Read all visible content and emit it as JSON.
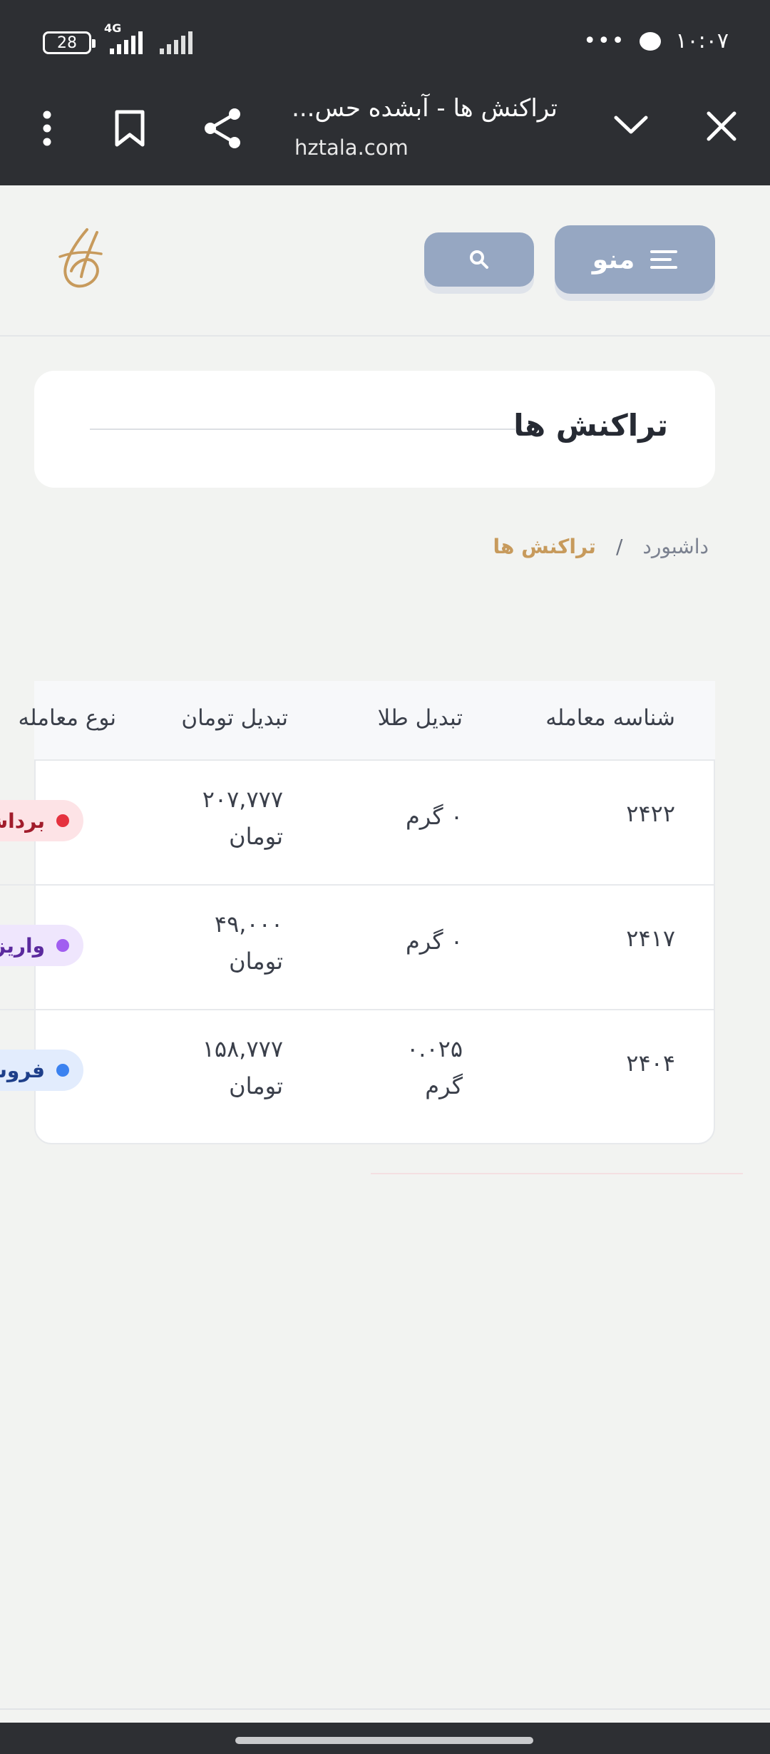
{
  "status_bar": {
    "battery": "28",
    "network": "4G",
    "time": "۱۰:۰۷",
    "more": "•••"
  },
  "browser": {
    "title": "تراکنش ها - آبشده حس...",
    "url": "hztala.com"
  },
  "header": {
    "menu_label": "منو"
  },
  "page": {
    "title": "تراکنش ها"
  },
  "breadcrumb": {
    "home": "داشبورد",
    "separator": "/",
    "current": "تراکنش ها"
  },
  "table": {
    "headers": {
      "id": "شناسه معامله",
      "gold": "تبدیل طلا",
      "toman": "تبدیل تومان",
      "type": "نوع معامله"
    },
    "rows": [
      {
        "id": "۲۴۲۲",
        "gold_value": "۰ گرم",
        "gold_unit": "",
        "toman_value": "۲۰۷,۷۷۷",
        "toman_unit": "تومان",
        "type": "برداشت",
        "type_color": "#e5323f",
        "type_bg": "#fde3e6",
        "type_text_color": "#a11c2b"
      },
      {
        "id": "۲۴۱۷",
        "gold_value": "۰ گرم",
        "gold_unit": "",
        "toman_value": "۴۹,۰۰۰",
        "toman_unit": "تومان",
        "type": "واریز",
        "type_color": "#a15ef0",
        "type_bg": "#efe6fd",
        "type_text_color": "#5b2a9e"
      },
      {
        "id": "۲۴۰۴",
        "gold_value": "۰.۰۲۵",
        "gold_unit": "گرم",
        "toman_value": "۱۵۸,۷۷۷",
        "toman_unit": "تومان",
        "type": "فروش",
        "type_color": "#3b82f0",
        "type_bg": "#e2ecfd",
        "type_text_color": "#1e3f8a"
      }
    ]
  },
  "colors": {
    "chrome_bg": "#2d2f33",
    "button_bg": "#96a7c2",
    "accent_gold": "#c79a5c"
  }
}
